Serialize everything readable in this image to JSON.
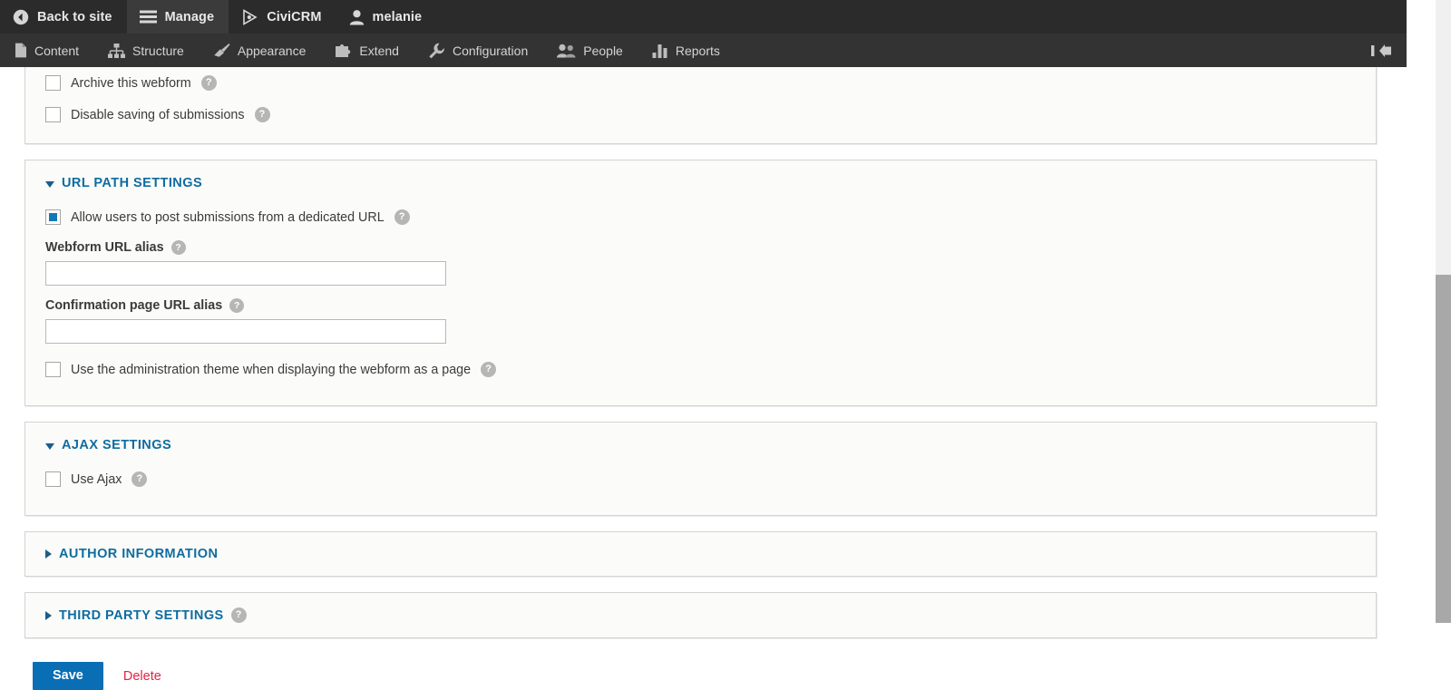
{
  "toolbar": {
    "tabs": [
      {
        "label": "Back to site",
        "icon": "back-arrow-circle-icon",
        "active": false
      },
      {
        "label": "Manage",
        "icon": "hamburger-icon",
        "active": true
      },
      {
        "label": "CiviCRM",
        "icon": "civicrm-triangle-icon",
        "active": false
      },
      {
        "label": "melanie",
        "icon": "user-icon",
        "active": false
      }
    ],
    "menu_items": [
      {
        "label": "Content",
        "icon": "document-icon"
      },
      {
        "label": "Structure",
        "icon": "sitemap-icon"
      },
      {
        "label": "Appearance",
        "icon": "paintbrush-icon"
      },
      {
        "label": "Extend",
        "icon": "puzzle-piece-icon"
      },
      {
        "label": "Configuration",
        "icon": "wrench-icon"
      },
      {
        "label": "People",
        "icon": "people-icon"
      },
      {
        "label": "Reports",
        "icon": "bar-chart-icon"
      }
    ],
    "orientation_toggle_icon": "toolbar-orientation-icon"
  },
  "form": {
    "top_panel": {
      "checkboxes": [
        {
          "label": "Archive this webform",
          "checked": false,
          "help": "?"
        },
        {
          "label": "Disable saving of submissions",
          "checked": false,
          "help": "?"
        }
      ]
    },
    "url_path_settings": {
      "title": "URL PATH SETTINGS",
      "expanded": true,
      "allow_dedicated_url": {
        "label": "Allow users to post submissions from a dedicated URL",
        "checked": true,
        "help": "?"
      },
      "webform_url_alias": {
        "label": "Webform URL alias",
        "value": "",
        "placeholder": "",
        "help": "?"
      },
      "confirmation_url_alias": {
        "label": "Confirmation page URL alias",
        "value": "",
        "placeholder": "",
        "help": "?"
      },
      "admin_theme": {
        "label": "Use the administration theme when displaying the webform as a page",
        "checked": false,
        "help": "?"
      }
    },
    "ajax_settings": {
      "title": "AJAX SETTINGS",
      "expanded": true,
      "use_ajax": {
        "label": "Use Ajax",
        "checked": false,
        "help": "?"
      }
    },
    "author_information": {
      "title": "AUTHOR INFORMATION",
      "expanded": false
    },
    "third_party_settings": {
      "title": "THIRD PARTY SETTINGS",
      "expanded": false,
      "help": "?"
    },
    "actions": {
      "save_label": "Save",
      "delete_label": "Delete"
    }
  },
  "colors": {
    "toolbar_bg": "#2b2b2b",
    "toolbar_menu_bg": "#333333",
    "link_blue": "#0f6ca0",
    "checkbox_blue": "#1279b6",
    "primary_button": "#0a6eb4",
    "danger_red": "#e02443",
    "panel_bg": "#fbfbf9"
  }
}
